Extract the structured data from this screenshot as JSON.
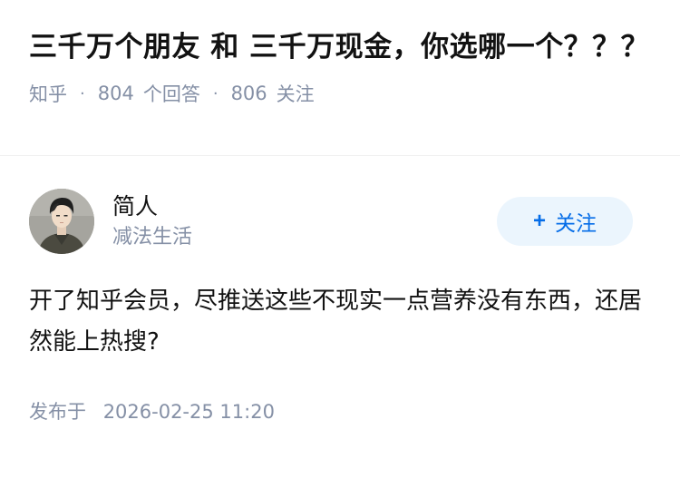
{
  "question": {
    "title": "三千万个朋友 和 三千万现金，你选哪一个？？？",
    "source": "知乎",
    "answer_count": "804",
    "answer_label": "个回答",
    "follower_count": "806",
    "follower_label": "关注",
    "separator": "·"
  },
  "answer": {
    "author": {
      "name": "简人",
      "headline": "减法生活",
      "avatar_icon": "avatar-man-portrait"
    },
    "follow_button": {
      "plus": "+",
      "label": "关注"
    },
    "content": "开了知乎会员，尽推送这些不现实一点营养没有东西，还居然能上热搜?",
    "time_label": "发布于",
    "time_value": "2026-02-25 11:20"
  },
  "colors": {
    "accent": "#056de8",
    "follow_bg": "#ebf5fd",
    "meta_text": "#8590a6",
    "main_text": "#121212"
  }
}
